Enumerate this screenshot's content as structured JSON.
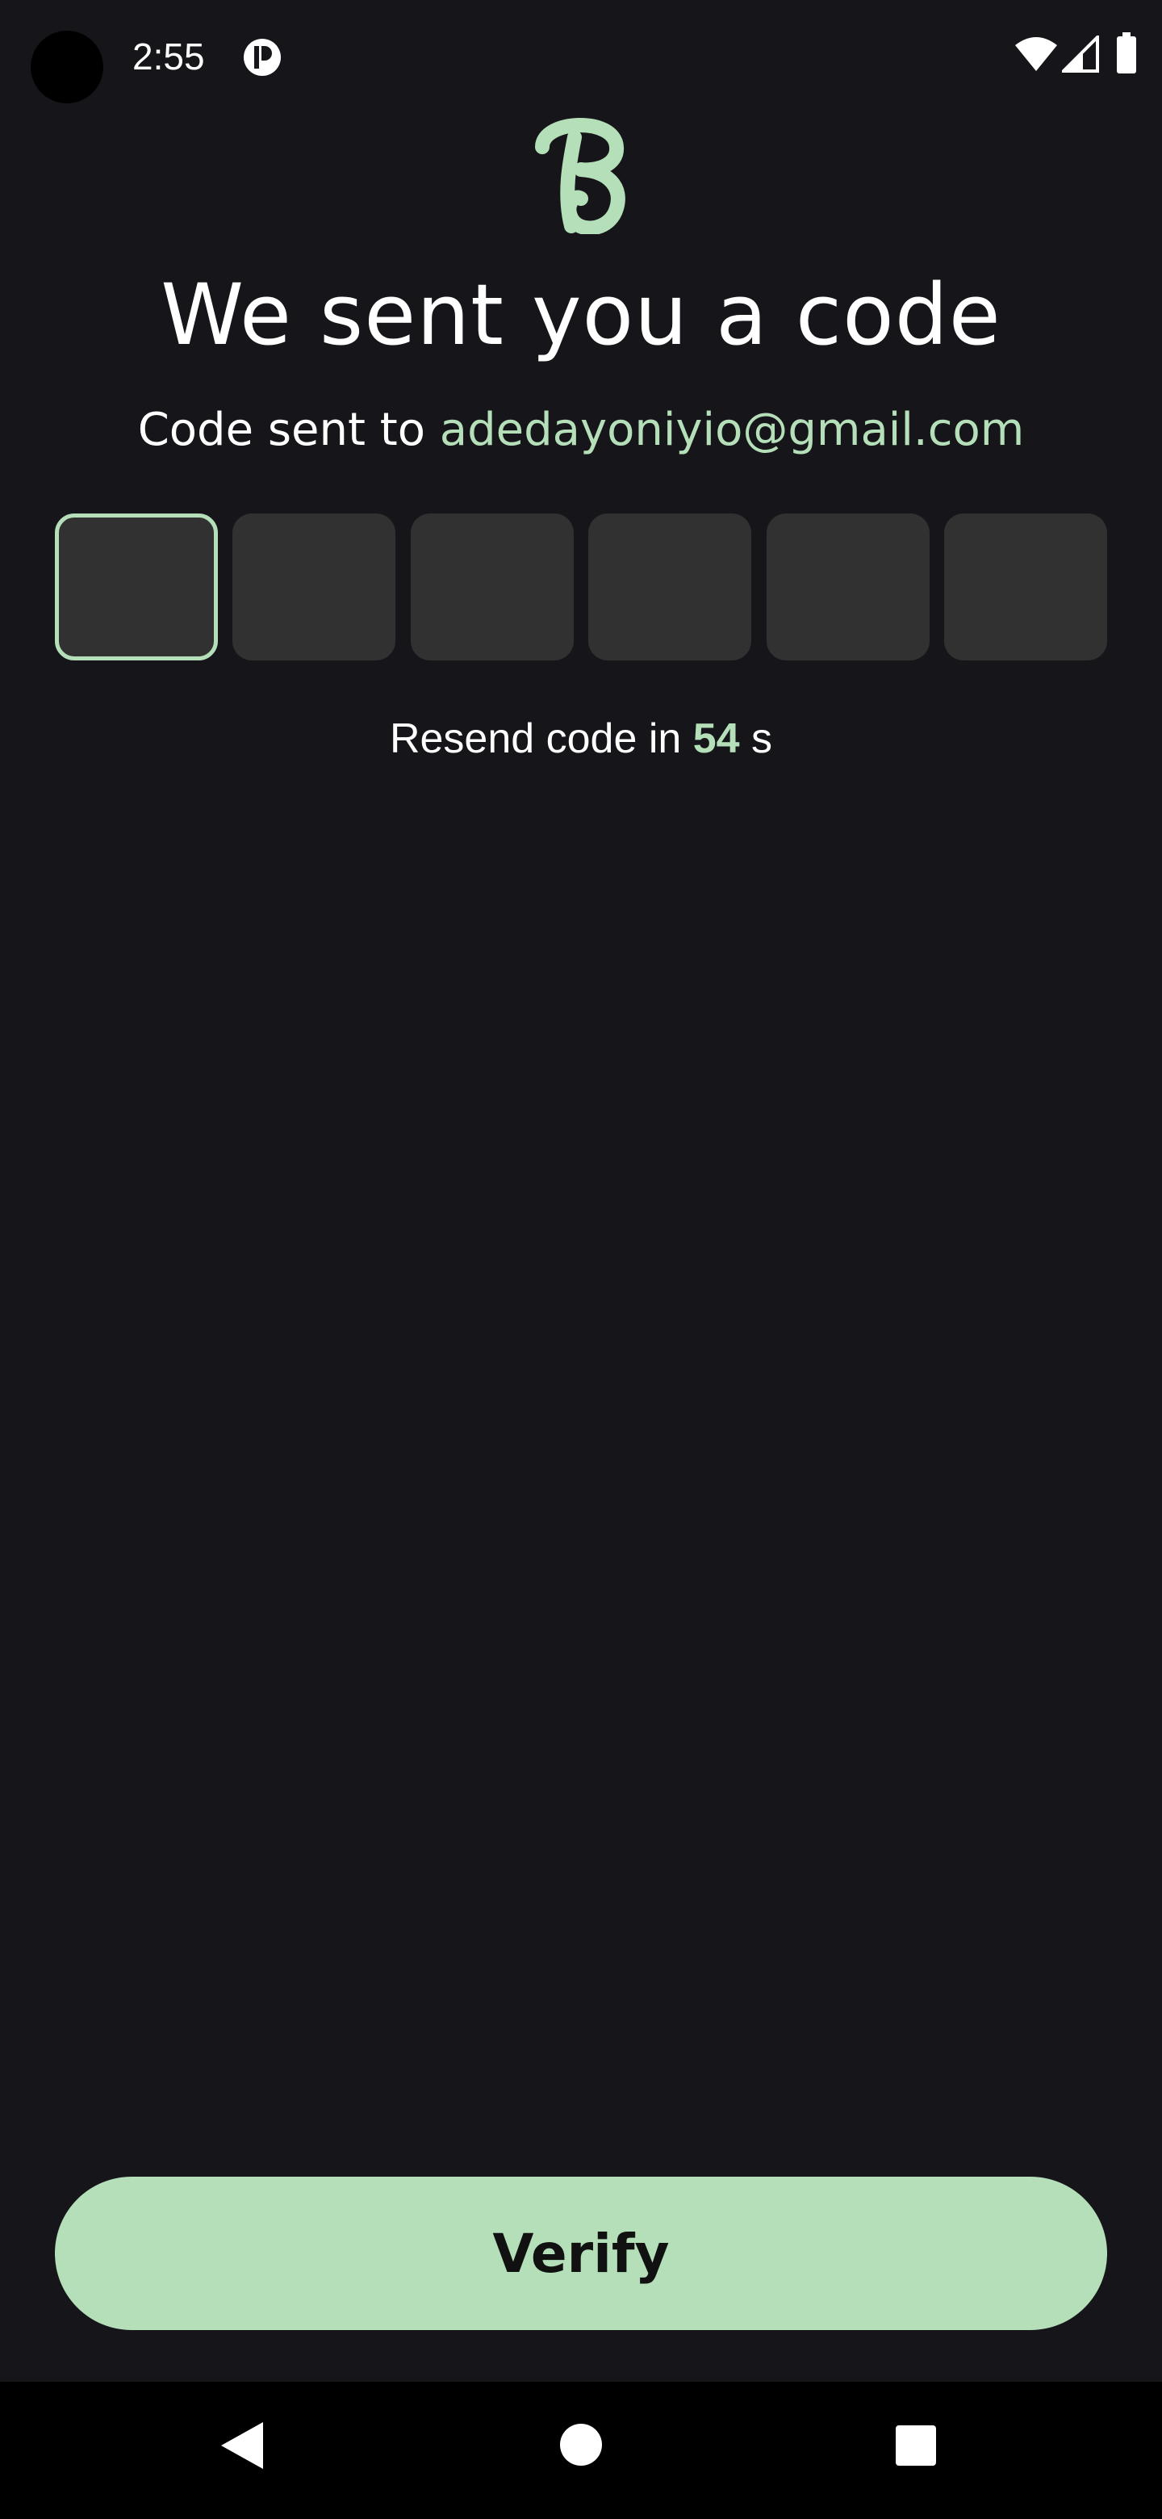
{
  "status_bar": {
    "time": "2:55",
    "icons": [
      "app-notification-icon",
      "wifi-icon",
      "cell-signal-icon",
      "battery-icon"
    ]
  },
  "app": {
    "logo_icon": "script-b-logo"
  },
  "title": "We sent you a code",
  "subtitle": {
    "prefix": "Code sent to",
    "email": "adedayoniyio@gmail.com"
  },
  "otp": {
    "length": 6,
    "values": [
      "",
      "",
      "",
      "",
      "",
      ""
    ],
    "active_index": 0
  },
  "resend": {
    "prefix": "Resend code in",
    "seconds": "54",
    "suffix": "s"
  },
  "verify_label": "Verify",
  "nav_bar": {
    "icons": [
      "back-icon",
      "home-icon",
      "recents-icon"
    ]
  },
  "colors": {
    "background": "#16161a",
    "accent": "#b4dfb9",
    "otp_box": "#313131",
    "text": "#ffffff"
  }
}
